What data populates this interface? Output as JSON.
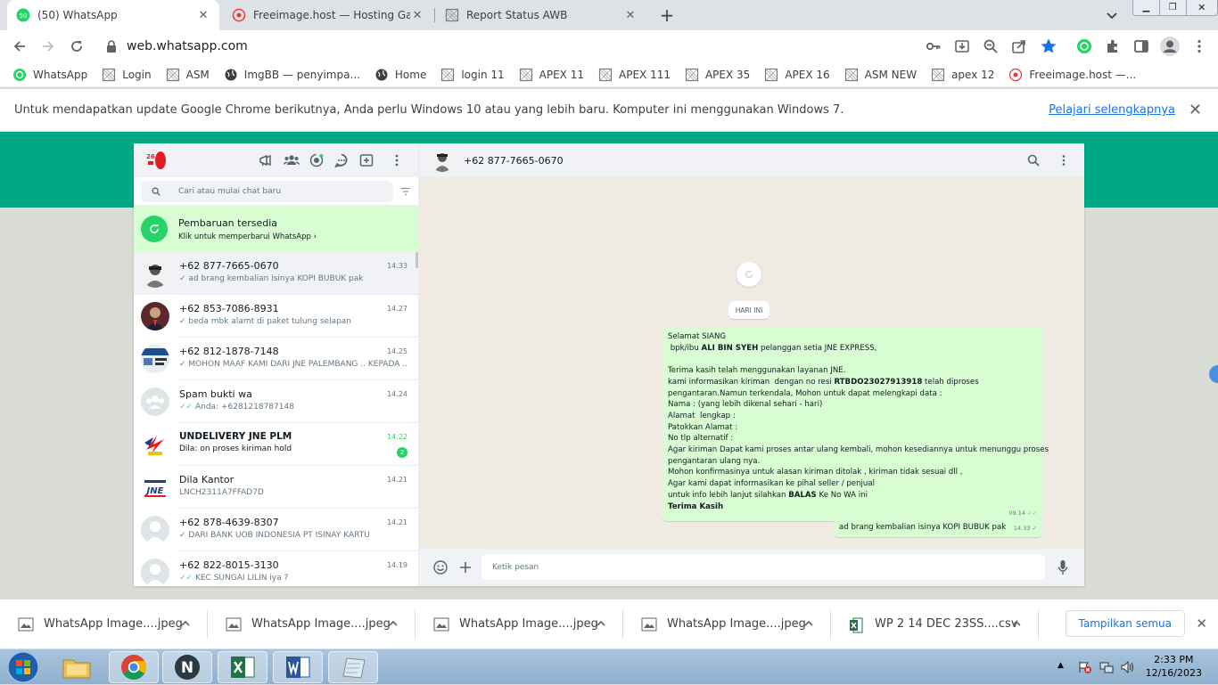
{
  "browser": {
    "tabs": [
      {
        "title": "(50) WhatsApp",
        "badge": "50",
        "active": true
      },
      {
        "title": "Freeimage.host — Hosting Gamb",
        "active": false
      },
      {
        "title": "Report Status AWB",
        "active": false
      }
    ],
    "url": "web.whatsapp.com",
    "bookmarks": [
      {
        "label": "WhatsApp",
        "icon": "whatsapp-icon"
      },
      {
        "label": "Login",
        "icon": "page-icon"
      },
      {
        "label": "ASM",
        "icon": "page-icon"
      },
      {
        "label": "ImgBB — penyimpa...",
        "icon": "globe-icon"
      },
      {
        "label": "Home",
        "icon": "globe-icon"
      },
      {
        "label": "login 11",
        "icon": "page-icon"
      },
      {
        "label": "APEX 11",
        "icon": "page-icon"
      },
      {
        "label": "APEX 111",
        "icon": "page-icon"
      },
      {
        "label": "APEX 35",
        "icon": "page-icon"
      },
      {
        "label": "APEX 16",
        "icon": "page-icon"
      },
      {
        "label": "ASM  NEW",
        "icon": "page-icon"
      },
      {
        "label": "apex 12",
        "icon": "page-icon"
      },
      {
        "label": "Freeimage.host —...",
        "icon": "freeimage-icon"
      }
    ],
    "infobar": {
      "message": "Untuk mendapatkan update Google Chrome berikutnya, Anda perlu Windows 10 atau yang lebih baru. Komputer ini menggunakan Windows 7.",
      "link": "Pelajari selengkapnya"
    }
  },
  "whatsapp": {
    "search_placeholder": "Cari atau mulai chat baru",
    "update": {
      "title": "Pembaruan tersedia",
      "subtitle": "Klik untuk memperbarui WhatsApp"
    },
    "chats": [
      {
        "name": "+62 877-7665-0670",
        "time": "14.33",
        "message": "ad brang kembalian    isinya KOPI BUBUK  pak",
        "tick": "✓",
        "avatar": "avatar-photo-1",
        "selected": true
      },
      {
        "name": "+62 853-7086-8931",
        "time": "14.27",
        "message": "beda  mbk  alamt di paket   tulung selapan",
        "tick": "✓",
        "avatar": "avatar-photo-2"
      },
      {
        "name": "+62 812-1878-7148",
        "time": "14.25",
        "message": "MOHON MAAF KAMI DARI JNE PALEMBANG .. KEPADA ...",
        "tick": "✓",
        "avatar": "avatar-photo-3"
      },
      {
        "name": "Spam bukti wa",
        "time": "14.24",
        "message": "Anda: +6281218787148",
        "tick": "✓✓",
        "avatar": "group-icon"
      },
      {
        "name": "UNDELIVERY JNE PLM",
        "time": "14.22",
        "message": "Dila: on proses kiriman hold",
        "tick": "",
        "avatar": "avatar-logo-jne",
        "unread": "2",
        "bold": true
      },
      {
        "name": "Dila Kantor",
        "time": "14.21",
        "message": "LNCH2311A7FFAD7D",
        "tick": "",
        "avatar": "avatar-jne"
      },
      {
        "name": "+62 878-4639-8307",
        "time": "14.21",
        "message": "DARI BANK UOB INDONESIA PT ISINAY    KARTU",
        "tick": "✓",
        "avatar": "default-avatar"
      },
      {
        "name": "+62 822-8015-3130",
        "time": "14.19",
        "message": "KEC  SUNGAI LILIN iya ?",
        "tick": "✓✓",
        "avatar": "default-avatar"
      }
    ],
    "conversation": {
      "contact": "+62 877-7665-0670",
      "date_chip": "HARI INI",
      "message_lines": [
        {
          "t": "Selamat SIANG"
        },
        {
          "t": " bpk/ibu ",
          "b": "ALI BIN SYEH",
          "t2": " pelanggan setia JNE EXPRESS,"
        },
        {
          "t": ""
        },
        {
          "t": "Terima kasih telah menggunakan layanan JNE."
        },
        {
          "t": "kami informasikan kiriman  dengan no resi ",
          "b": "RTBDO23027913918",
          "t2": " telah diproses"
        },
        {
          "t": "pengantaran.Namun terkendala, Mohon untuk dapat melengkapi data :"
        },
        {
          "t": "Nama : (yang lebih dikenal sehari - hari)"
        },
        {
          "t": "Alamat  lengkap :"
        },
        {
          "t": "Patokkan Alamat :"
        },
        {
          "t": "No tlp alternatif :"
        },
        {
          "t": "Agar kiriman Dapat kami proses antar ulang kembali, mohon kesediannya untuk menunggu proses"
        },
        {
          "t": "pengantaran ulang nya."
        },
        {
          "t": "Mohon konfirmasinya untuk alasan kiriman ditolak , kiriman tidak sesuai dll ,"
        },
        {
          "t": "Agar kami dapat informasikan ke pihal seller / penjual"
        },
        {
          "t": "untuk info lebih lanjut silahkan ",
          "b": "BALAS",
          "t2": " Ke No WA ini"
        },
        {
          "b": "Terima Kasih"
        }
      ],
      "message_time": "09.14",
      "reply": "ad brang kembalian    isinya KOPI BUBUK  pak",
      "reply_time": "14.33",
      "input_placeholder": "Ketik pesan"
    }
  },
  "downloads": {
    "items": [
      "WhatsApp Image....jpeg",
      "WhatsApp Image....jpeg",
      "WhatsApp Image....jpeg",
      "WhatsApp Image....jpeg",
      "WP 2 14 DEC 23SS....csv"
    ],
    "show_all": "Tampilkan semua"
  },
  "taskbar": {
    "time": "2:33 PM",
    "date": "12/16/2023"
  },
  "colors": {
    "wa_green": "#00a884",
    "bubble_out": "#d9fdd3",
    "chrome_blue": "#1a73e8"
  }
}
